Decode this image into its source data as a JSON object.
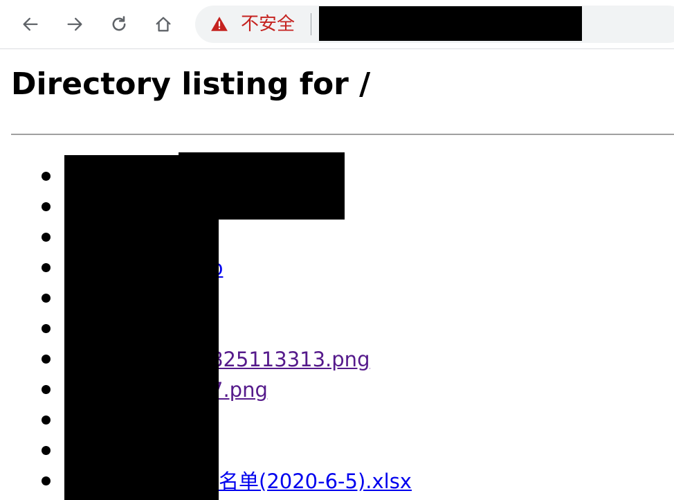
{
  "browser": {
    "back_icon": "arrow-left-icon",
    "forward_icon": "arrow-right-icon",
    "reload_icon": "reload-icon",
    "home_icon": "home-icon",
    "security_label": "不安全",
    "security_color": "#c5221f"
  },
  "page": {
    "title": "Directory listing for /",
    "files": [
      {
        "name": "",
        "visited": false
      },
      {
        "name": "",
        "visited": false
      },
      {
        "name": "",
        "visited": false
      },
      {
        "name": "p",
        "visited": false
      },
      {
        "name": "",
        "visited": false
      },
      {
        "name": "",
        "visited": false
      },
      {
        "name": "825113313.png",
        "visited": true
      },
      {
        "name": "7.png",
        "visited": true
      },
      {
        "name": "",
        "visited": false
      },
      {
        "name": "",
        "visited": false
      },
      {
        "name": "名单(2020-6-5).xlsx",
        "visited": false
      }
    ]
  },
  "colors": {
    "link": "#0000ee",
    "visited_link": "#551a8b"
  }
}
